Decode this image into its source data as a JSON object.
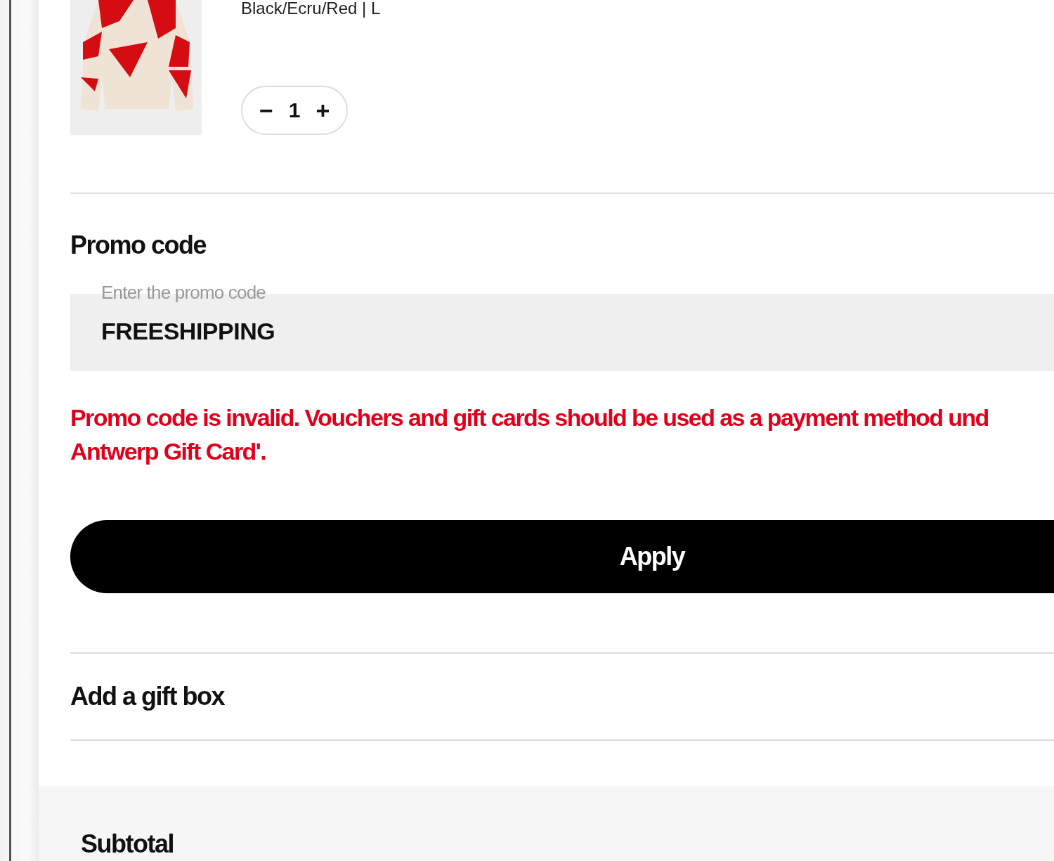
{
  "product": {
    "variant": "Black/Ecru/Red | L",
    "quantity": {
      "decrease": "−",
      "value": "1",
      "increase": "+"
    }
  },
  "promo": {
    "title": "Promo code",
    "field": {
      "placeholder": "Enter the promo code",
      "value": "FREESHIPPING"
    },
    "error_lines": [
      "Promo code is invalid. Vouchers and gift cards should be used as a payment method und",
      "Antwerp Gift Card'."
    ],
    "button": "Apply"
  },
  "gift_box": {
    "title": "Add a gift box"
  },
  "summary": {
    "title": "Subtotal"
  }
}
